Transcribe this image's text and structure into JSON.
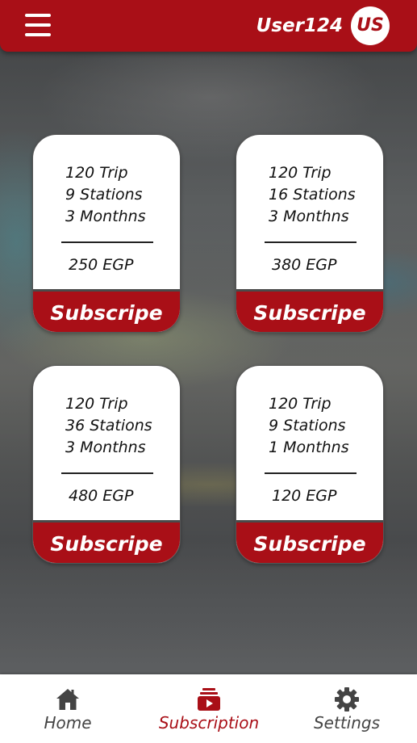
{
  "header": {
    "username": "User124",
    "avatar_initials": "US"
  },
  "plans": [
    {
      "trips": "120 Trip",
      "stations": "9 Stations",
      "duration": "3 Monthns",
      "price": "250 EGP",
      "action": "Subscripe"
    },
    {
      "trips": "120 Trip",
      "stations": "16 Stations",
      "duration": "3 Monthns",
      "price": "380 EGP",
      "action": "Subscripe"
    },
    {
      "trips": "120 Trip",
      "stations": "36 Stations",
      "duration": "3 Monthns",
      "price": "480 EGP",
      "action": "Subscripe"
    },
    {
      "trips": "120 Trip",
      "stations": "9 Stations",
      "duration": "1 Monthns",
      "price": "120 EGP",
      "action": "Subscripe"
    }
  ],
  "nav": {
    "items": [
      {
        "label": "Home",
        "icon": "home-icon",
        "active": false
      },
      {
        "label": "Subscription",
        "icon": "subscription-icon",
        "active": true
      },
      {
        "label": "Settings",
        "icon": "gear-icon",
        "active": false
      }
    ]
  },
  "colors": {
    "brand_red": "#a90f17",
    "inactive_nav": "#444444",
    "card_background": "#ffffff"
  }
}
